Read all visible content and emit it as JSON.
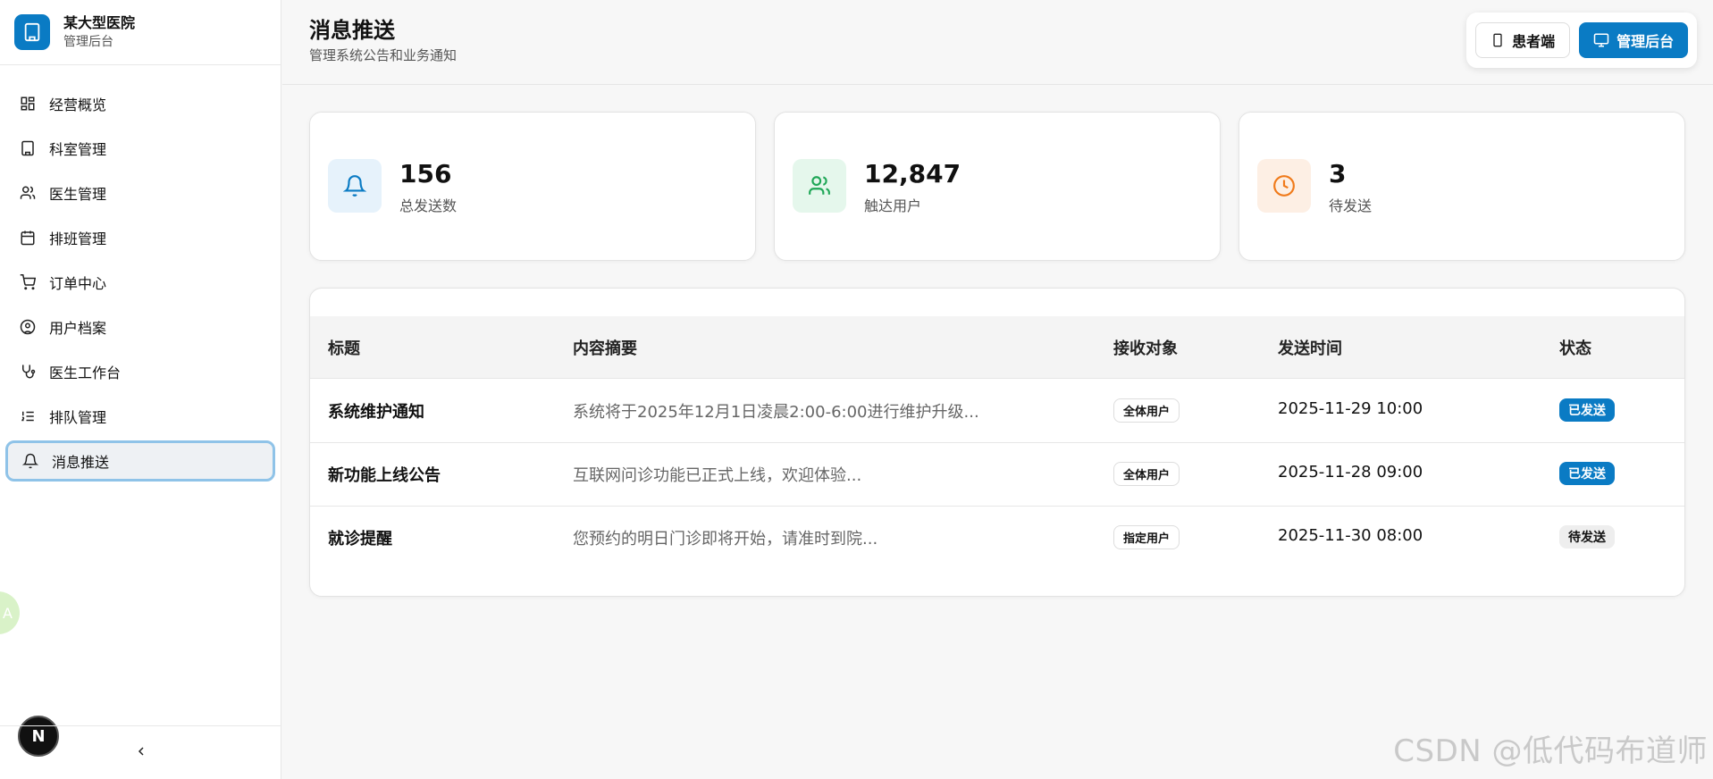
{
  "brand": {
    "name": "某大型医院",
    "subtitle": "管理后台"
  },
  "sidebar": {
    "items": [
      {
        "label": "经营概览",
        "icon": "dashboard-icon"
      },
      {
        "label": "科室管理",
        "icon": "building-icon"
      },
      {
        "label": "医生管理",
        "icon": "users-icon"
      },
      {
        "label": "排班管理",
        "icon": "calendar-icon"
      },
      {
        "label": "订单中心",
        "icon": "cart-icon"
      },
      {
        "label": "用户档案",
        "icon": "user-circle-icon"
      },
      {
        "label": "医生工作台",
        "icon": "stethoscope-icon"
      },
      {
        "label": "排队管理",
        "icon": "list-ordered-icon"
      },
      {
        "label": "消息推送",
        "icon": "bell-icon",
        "active": true
      }
    ],
    "collapse_icon": "chevron-left-icon",
    "badge_letter": "N",
    "float_letter": "A"
  },
  "header": {
    "title": "消息推送",
    "subtitle": "管理系统公告和业务通知",
    "switch_patient": "患者端",
    "switch_admin": "管理后台"
  },
  "stats": [
    {
      "value": "156",
      "label": "总发送数",
      "icon": "bell-icon",
      "color": "#0a7bc4",
      "bg": "#e6f2fb"
    },
    {
      "value": "12,847",
      "label": "触达用户",
      "icon": "users-icon",
      "color": "#1fa757",
      "bg": "#e5f7ec"
    },
    {
      "value": "3",
      "label": "待发送",
      "icon": "clock-icon",
      "color": "#f07a1a",
      "bg": "#fdefe4"
    }
  ],
  "table": {
    "headers": [
      "标题",
      "内容摘要",
      "接收对象",
      "发送时间",
      "状态"
    ],
    "rows": [
      {
        "title": "系统维护通知",
        "summary": "系统将于2025年12月1日凌晨2:00-6:00进行维护升级...",
        "target": "全体用户",
        "time": "2025-11-29 10:00",
        "status": "已发送",
        "status_type": "sent"
      },
      {
        "title": "新功能上线公告",
        "summary": "互联网问诊功能已正式上线，欢迎体验...",
        "target": "全体用户",
        "time": "2025-11-28 09:00",
        "status": "已发送",
        "status_type": "sent"
      },
      {
        "title": "就诊提醒",
        "summary": "您预约的明日门诊即将开始，请准时到院...",
        "target": "指定用户",
        "time": "2025-11-30 08:00",
        "status": "待发送",
        "status_type": "pending"
      }
    ]
  },
  "watermark": "CSDN @低代码布道师",
  "colors": {
    "accent": "#0a7bc4"
  }
}
